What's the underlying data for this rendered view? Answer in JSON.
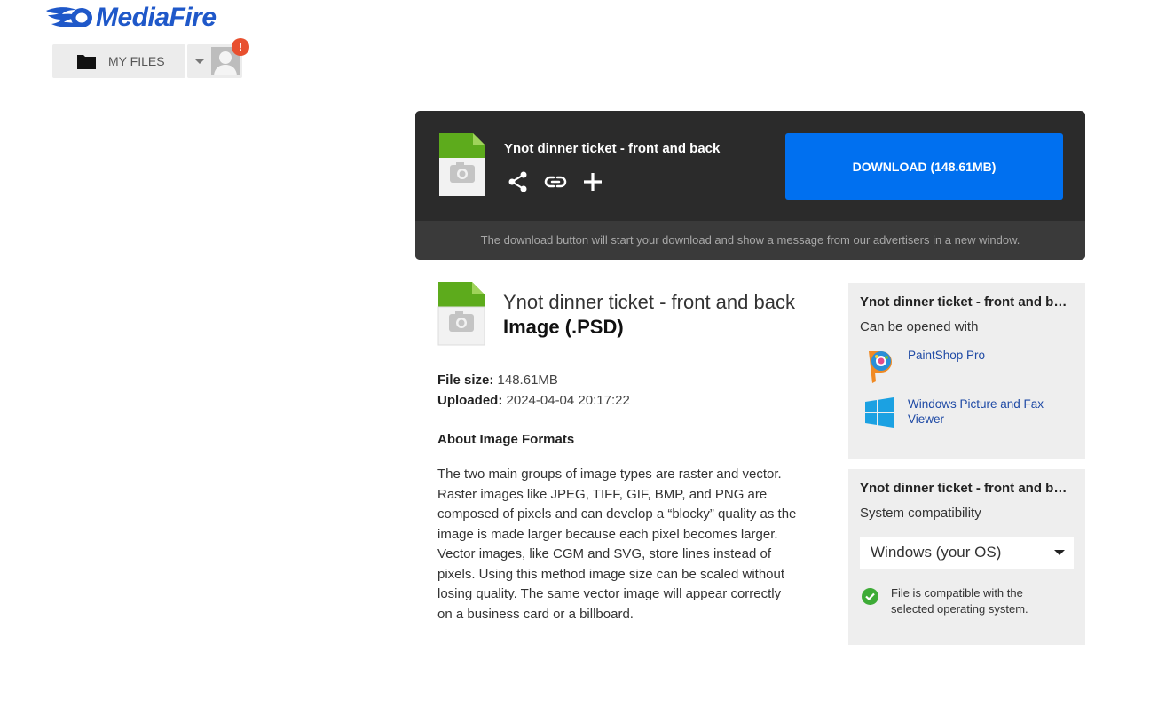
{
  "header": {
    "brand": "MediaFire",
    "my_files_label": "MY FILES",
    "alert_badge": "!"
  },
  "download_card": {
    "file_name": "Ynot dinner ticket - front and back",
    "download_label": "DOWNLOAD (148.61MB)",
    "note": "The download button will start your download and show a message from our advertisers in a new window."
  },
  "file_info": {
    "title": "Ynot dinner ticket - front and back",
    "type": "Image (.PSD)",
    "file_size_label": "File size:",
    "file_size": "148.61MB",
    "uploaded_label": "Uploaded:",
    "uploaded": "2024-04-04 20:17:22",
    "about_heading": "About Image Formats",
    "about_text": "The two main groups of image types are raster and vector. Raster images like JPEG, TIFF, GIF, BMP, and PNG are composed of pixels and can develop a “blocky” quality as the image is made larger because each pixel becomes larger. Vector images, like CGM and SVG, store lines instead of pixels. Using this method image size can be scaled without losing quality. The same vector image will appear correctly on a business card or a billboard."
  },
  "open_with_panel": {
    "title": "Ynot dinner ticket - front and back",
    "subtitle": "Can be opened with",
    "apps": [
      {
        "name": "PaintShop Pro",
        "icon": "paintshop-pro-icon"
      },
      {
        "name": "Windows Picture and Fax Viewer",
        "icon": "windows-icon"
      }
    ]
  },
  "compat_panel": {
    "title": "Ynot dinner ticket - front and back",
    "subtitle": "System compatibility",
    "selected_os": "Windows (your OS)",
    "status": "File is compatible with the selected operating system."
  },
  "colors": {
    "brand": "#1f58c9",
    "download_button": "#0070f0",
    "card_bg": "#2b2b2b",
    "file_icon_green": "#5dab1c",
    "check_green": "#3dab36",
    "alert": "#e8502f"
  }
}
